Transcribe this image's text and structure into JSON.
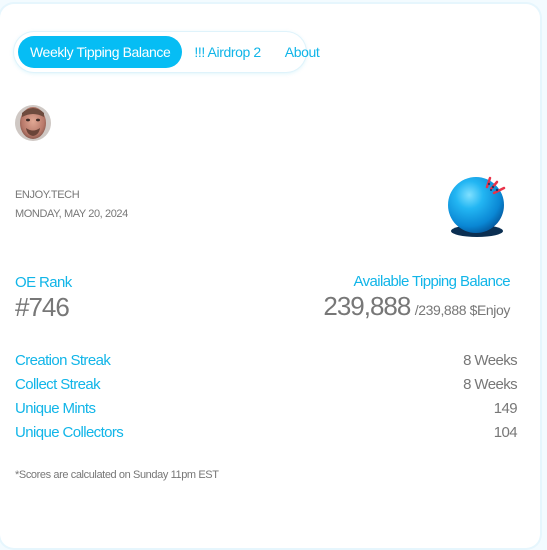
{
  "nav": {
    "tabs": [
      {
        "label": "Weekly Tipping Balance",
        "active": true
      },
      {
        "label": "!!! Airdrop 2",
        "active": false
      },
      {
        "label": "About",
        "active": false
      }
    ]
  },
  "profile": {
    "brand": "ENJOY.TECH",
    "date": "MONDAY, MAY 20, 2024"
  },
  "rank": {
    "label": "OE Rank",
    "value": "#746"
  },
  "balance": {
    "label": "Available Tipping Balance",
    "value": "239,888",
    "total": "/239,888 $Enjoy"
  },
  "stats": [
    {
      "label": "Creation Streak",
      "value": "8 Weeks"
    },
    {
      "label": "Collect Streak",
      "value": "8 Weeks"
    },
    {
      "label": "Unique Mints",
      "value": "149"
    },
    {
      "label": "Unique Collectors",
      "value": "104"
    }
  ],
  "footnote": "*Scores are calculated on Sunday 11pm EST",
  "colors": {
    "accent": "#06bdf4",
    "accent_text": "#11b5e8",
    "muted_text": "#777777",
    "logo_ball": "#1aa0e6",
    "logo_marks": "#e8334a"
  },
  "icons": {
    "avatar": "user-avatar-photo",
    "logo": "enjoy-ball-logo"
  }
}
